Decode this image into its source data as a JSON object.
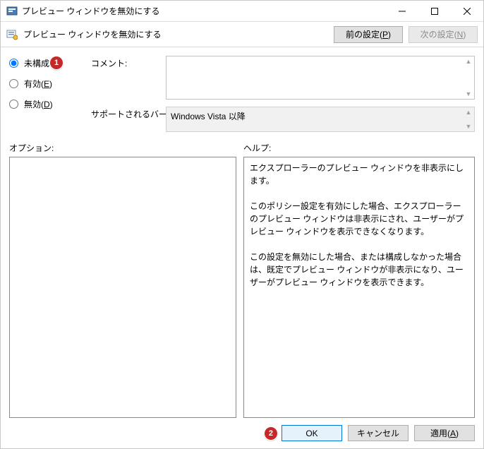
{
  "window": {
    "title": "プレビュー ウィンドウを無効にする"
  },
  "toolbar": {
    "policy_title": "プレビュー ウィンドウを無効にする",
    "prev_label_pre": "前の設定(",
    "prev_label_key": "P",
    "prev_label_post": ")",
    "next_label_pre": "次の設定(",
    "next_label_key": "N",
    "next_label_post": ")"
  },
  "state": {
    "not_configured": {
      "label": "未構成",
      "selected": true
    },
    "enabled": {
      "label_pre": "有効(",
      "label_key": "E",
      "label_post": ")",
      "selected": false
    },
    "disabled": {
      "label_pre": "無効(",
      "label_key": "D",
      "label_post": ")",
      "selected": false
    }
  },
  "labels": {
    "comment": "コメント:",
    "supported": "サポートされるバージョン:",
    "options": "オプション:",
    "help": "ヘルプ:"
  },
  "fields": {
    "comment_value": "",
    "supported_value": "Windows Vista 以降",
    "options_value": "",
    "help_value": "エクスプローラーのプレビュー ウィンドウを非表示にします。\n\nこのポリシー設定を有効にした場合、エクスプローラーのプレビュー ウィンドウは非表示にされ、ユーザーがプレビュー ウィンドウを表示できなくなります。\n\nこの設定を無効にした場合、または構成しなかった場合は、既定でプレビュー ウィンドウが非表示になり、ユーザーがプレビュー ウィンドウを表示できます。"
  },
  "buttons": {
    "ok": "OK",
    "cancel": "キャンセル",
    "apply_pre": "適用(",
    "apply_key": "A",
    "apply_post": ")"
  },
  "callouts": {
    "one": "1",
    "two": "2"
  }
}
